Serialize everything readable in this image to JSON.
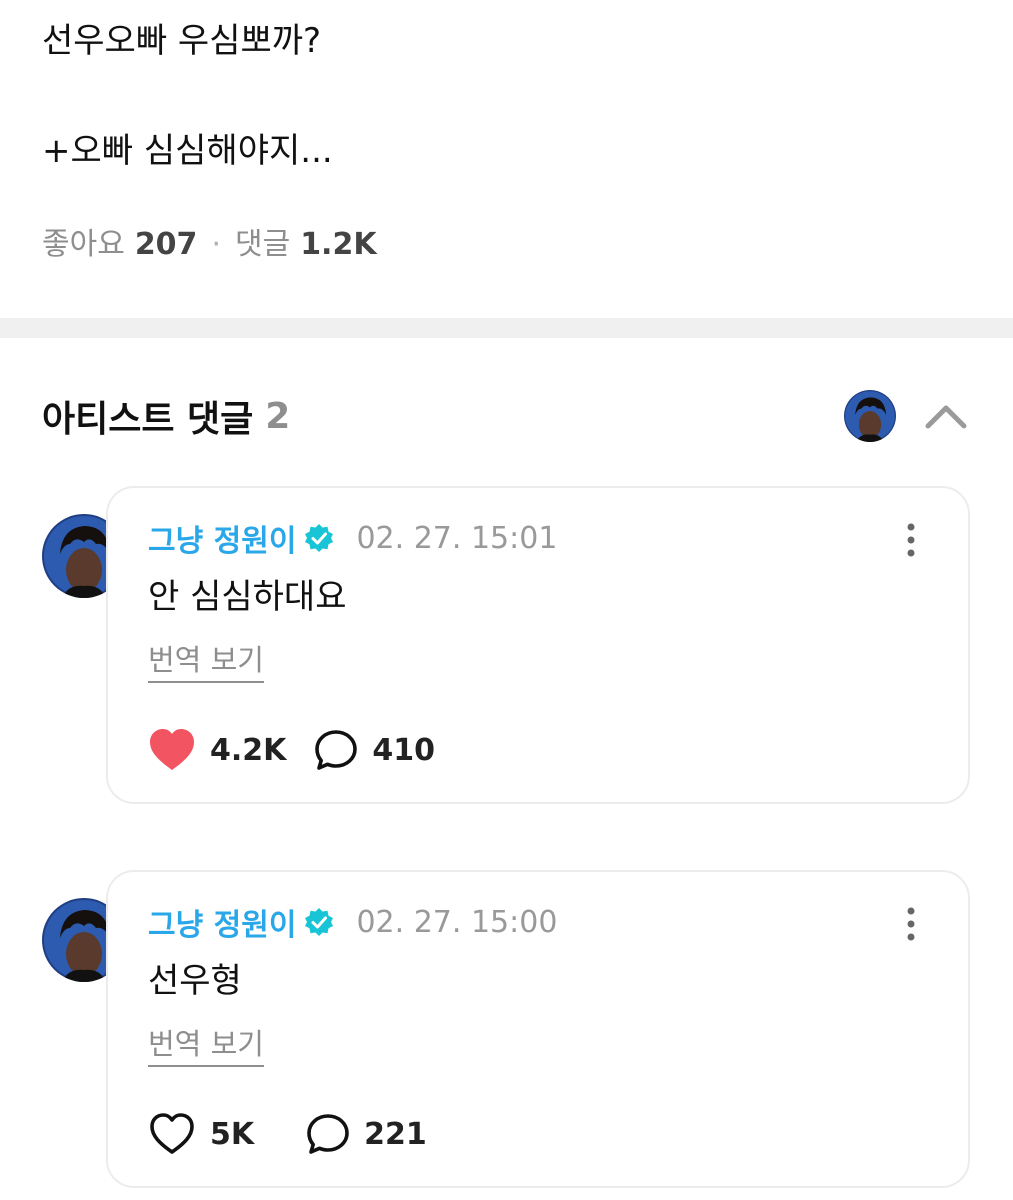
{
  "post": {
    "line1": "선우오빠 우심뽀까?",
    "line2": "+오빠 심심해야지..."
  },
  "stats": {
    "likes_label": "좋아요",
    "likes_count": "207",
    "separator": "·",
    "comments_label": "댓글",
    "comments_count": "1.2K"
  },
  "artist_comments": {
    "title": "아티스트 댓글",
    "count": "2"
  },
  "comments": [
    {
      "author": "그냥 정원이",
      "timestamp": "02. 27. 15:01",
      "text": "안 심심하대요",
      "translate_label": "번역 보기",
      "likes": "4.2K",
      "liked": true,
      "replies": "410"
    },
    {
      "author": "그냥 정원이",
      "timestamp": "02. 27. 15:00",
      "text": "선우형",
      "translate_label": "번역 보기",
      "likes": "5K",
      "liked": false,
      "replies": "221"
    }
  ],
  "colors": {
    "author": "#2aa7e8",
    "verified_badge": "#19c4d6",
    "heart_filled": "#f25462",
    "muted_text": "#8e8e8e",
    "divider": "#f0f0f0"
  },
  "icons": {
    "verified": "verified-badge-icon",
    "collapse": "chevron-up-icon",
    "more": "more-vertical-icon",
    "like": "heart-icon",
    "reply": "speech-bubble-icon"
  }
}
